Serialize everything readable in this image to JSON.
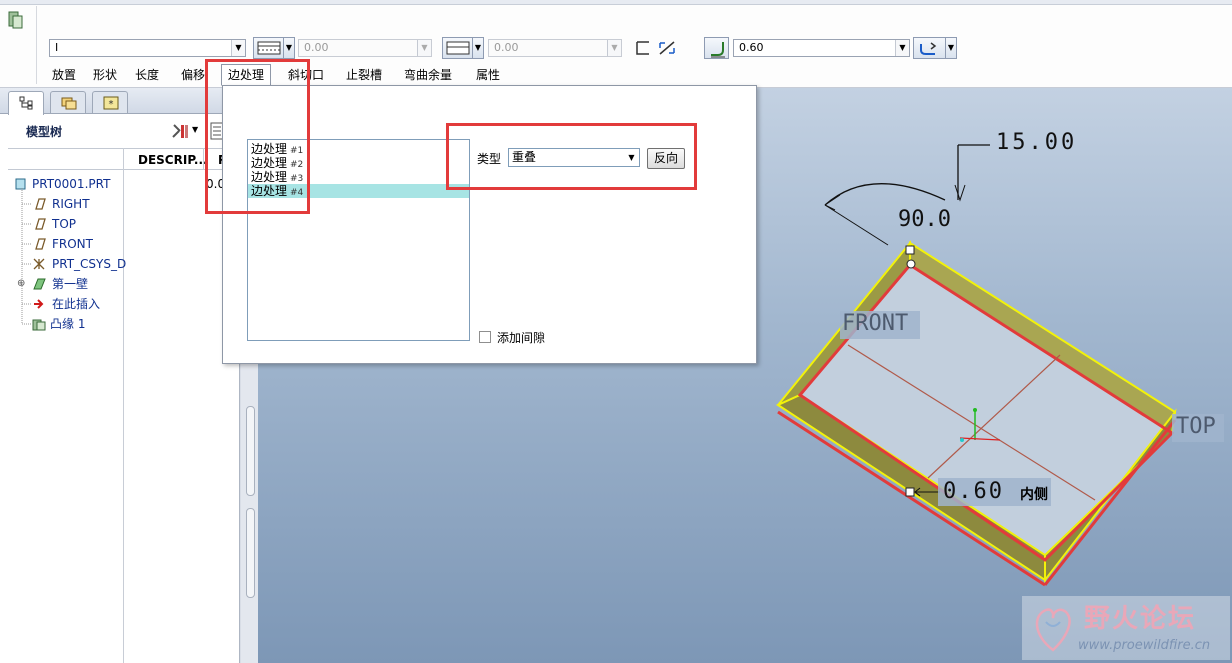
{
  "toolbar": {
    "profile_value": "I",
    "thickness_1": "0.00",
    "thickness_2": "0.00",
    "radius_value": "0.60"
  },
  "ribbon_tabs": [
    {
      "label": "放置"
    },
    {
      "label": "形状"
    },
    {
      "label": "长度"
    },
    {
      "label": "偏移"
    },
    {
      "label": "边处理"
    },
    {
      "label": "斜切口"
    },
    {
      "label": "止裂槽"
    },
    {
      "label": "弯曲余量"
    },
    {
      "label": "属性"
    }
  ],
  "model_tree": {
    "title": "模型树",
    "col_description": "DESCRIP...",
    "col_pr": "PR",
    "pr_value": "0.0",
    "items": [
      {
        "label": "PRT0001.PRT"
      },
      {
        "label": "RIGHT"
      },
      {
        "label": "TOP"
      },
      {
        "label": "FRONT"
      },
      {
        "label": "PRT_CSYS_D"
      },
      {
        "label": "第一壁"
      },
      {
        "label": "在此插入"
      },
      {
        "label": "凸缘 1"
      }
    ]
  },
  "edge_panel": {
    "items": [
      {
        "label": "边处理",
        "num": "#1"
      },
      {
        "label": "边处理",
        "num": "#2"
      },
      {
        "label": "边处理",
        "num": "#3"
      },
      {
        "label": "边处理",
        "num": "#4"
      }
    ],
    "selected_index": 3,
    "type_label": "类型",
    "type_value": "重叠",
    "reverse_label": "反向",
    "add_gap_label": "添加间隙"
  },
  "viewport": {
    "dim_length": "15.00",
    "dim_angle": "90.0",
    "label_front": "FRONT",
    "label_top": "TOP",
    "dim_radius": "0.60",
    "dim_radius_side": "内侧"
  },
  "watermark": {
    "text": "野火论坛",
    "url": "www.proewildfire.cn"
  },
  "colors": {
    "highlight_red": "#e23b3b",
    "edge_yellow": "#f2f20a",
    "selection_cyan": "#a7e4e4"
  }
}
